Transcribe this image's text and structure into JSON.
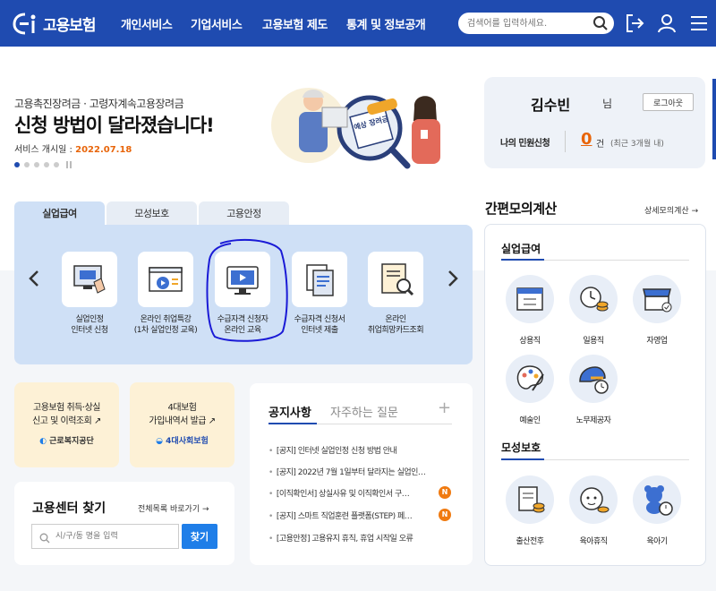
{
  "header": {
    "logo_text": "고용보험",
    "nav": [
      "개인서비스",
      "기업서비스",
      "고용보험 제도",
      "통계 및 정보공개"
    ],
    "search_placeholder": "검색어를 입력하세요."
  },
  "hero": {
    "subtitle": "고용촉진장려금 · 고령자계속고용장려금",
    "title": "신청 방법이 달라졌습니다!",
    "date_label": "서비스 개시일 : ",
    "date": "2022.07.18",
    "illustration_text": "예상 장려금"
  },
  "user": {
    "name": "김수빈",
    "suffix": "님",
    "logout_label": "로그아웃",
    "my_apps_label": "나의 민원신청",
    "my_apps_count": "0",
    "my_apps_unit": "건",
    "my_apps_note": "(최근 3개월 내)"
  },
  "service_tabs": [
    "실업급여",
    "모성보호",
    "고용안정"
  ],
  "services": [
    {
      "line1": "실업인정",
      "line2": "인터넷 신청"
    },
    {
      "line1": "온라인 취업특강",
      "line2": "(1차 실업인정 교육)"
    },
    {
      "line1": "수급자격 신청자",
      "line2": "온라인 교육"
    },
    {
      "line1": "수급자격 신청서",
      "line2": "인터넷 제출"
    },
    {
      "line1": "온라인",
      "line2": "취업희망카드조회"
    }
  ],
  "quick": [
    {
      "line1": "고용보험 취득·상실",
      "line2": "신고 및 이력조회",
      "org": "근로복지공단"
    },
    {
      "line1": "4대보험",
      "line2": "가입내역서 발급",
      "org": "4대사회보험"
    }
  ],
  "finder": {
    "title": "고용센터 찾기",
    "all_link": "전체목록 바로가기",
    "placeholder": "시/구/동 명을 입력",
    "button": "찾기"
  },
  "notice": {
    "tabs": [
      "공지사항",
      "자주하는 질문"
    ],
    "items": [
      {
        "text": "[공지] 인터넷 실업인정 신청 방법 안내",
        "new": false
      },
      {
        "text": "[공지] 2022년 7월 1일부터 달라지는 실업인…",
        "new": false
      },
      {
        "text": "[이직확인서] 상실사유 및 이직확인서 구…",
        "new": true
      },
      {
        "text": "[공지] 스마트 직업훈련 플랫폼(STEP) 페…",
        "new": true
      },
      {
        "text": "[고용안정] 고용유지 휴직, 휴업 시작일 오류",
        "new": false
      }
    ],
    "new_badge": "N"
  },
  "calc": {
    "title": "간편모의계산",
    "detail_link": "상세모의계산",
    "sections": [
      {
        "name": "실업급여",
        "items": [
          "상용직",
          "일용직",
          "자영업",
          "예술인",
          "노무제공자"
        ]
      },
      {
        "name": "모성보호",
        "items": [
          "출산전후",
          "육아휴직",
          "육아기"
        ]
      }
    ]
  },
  "colors": {
    "primary": "#1f4bb0",
    "accent": "#e8650a",
    "panel": "#cfe0f6",
    "annotation": "#1a1ad6"
  }
}
